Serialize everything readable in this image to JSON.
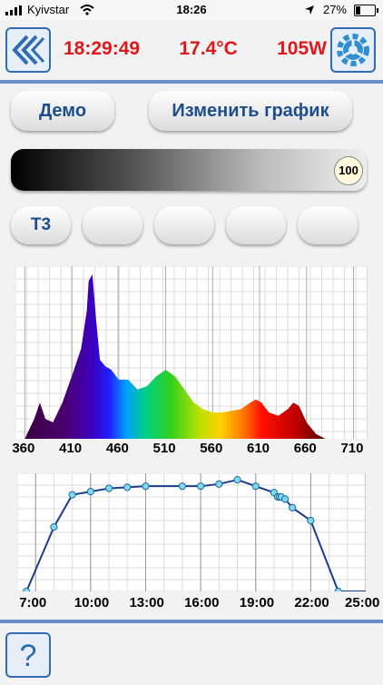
{
  "status_bar": {
    "carrier": "Kyivstar",
    "time": "18:26",
    "battery": "27%",
    "battery_level": 0.27
  },
  "header": {
    "clock": "18:29:49",
    "temperature": "17.4°C",
    "power": "105W",
    "back_icon": "double-chevron-left-icon",
    "settings_icon": "gear-icon"
  },
  "buttons": {
    "demo": "Демо",
    "edit_schedule": "Изменить график"
  },
  "brightness": {
    "value": "100"
  },
  "presets": [
    {
      "label": "Т3"
    },
    {
      "label": ""
    },
    {
      "label": ""
    },
    {
      "label": ""
    },
    {
      "label": ""
    }
  ],
  "spectrum": {
    "x_ticks": [
      "360",
      "410",
      "460",
      "510",
      "560",
      "610",
      "660",
      "710"
    ]
  },
  "schedule": {
    "x_ticks": [
      "7:00",
      "10:00",
      "13:00",
      "16:00",
      "19:00",
      "22:00",
      "25:00"
    ]
  },
  "chart_data": [
    {
      "type": "area",
      "x": [
        360,
        370,
        376,
        382,
        390,
        400,
        410,
        420,
        426,
        428,
        432,
        436,
        440,
        446,
        452,
        460,
        470,
        480,
        490,
        500,
        510,
        520,
        530,
        540,
        550,
        560,
        570,
        580,
        590,
        600,
        606,
        612,
        620,
        630,
        640,
        646,
        652,
        660,
        670,
        680,
        700,
        720
      ],
      "y": [
        0,
        12,
        22,
        12,
        10,
        22,
        38,
        55,
        78,
        96,
        100,
        72,
        48,
        44,
        42,
        36,
        36,
        30,
        32,
        38,
        42,
        38,
        30,
        22,
        18,
        16,
        16,
        17,
        18,
        22,
        24,
        22,
        16,
        14,
        18,
        22,
        20,
        10,
        3,
        0,
        0,
        0
      ],
      "xlim": [
        350,
        725
      ],
      "ylim": [
        0,
        105
      ],
      "grid": true
    },
    {
      "type": "line",
      "x": [
        6.5,
        8,
        9,
        10,
        11,
        12,
        13,
        15,
        16,
        17,
        18,
        19,
        20,
        20.2,
        20.3,
        20.4,
        20.6,
        21,
        22,
        23.5
      ],
      "y": [
        0,
        60,
        90,
        93,
        96,
        97,
        98,
        98,
        98,
        100,
        104,
        98,
        92,
        88,
        88,
        88,
        86,
        78,
        66,
        0
      ],
      "xlim": [
        6,
        25
      ],
      "ylim": [
        0,
        110
      ],
      "grid": true
    }
  ]
}
